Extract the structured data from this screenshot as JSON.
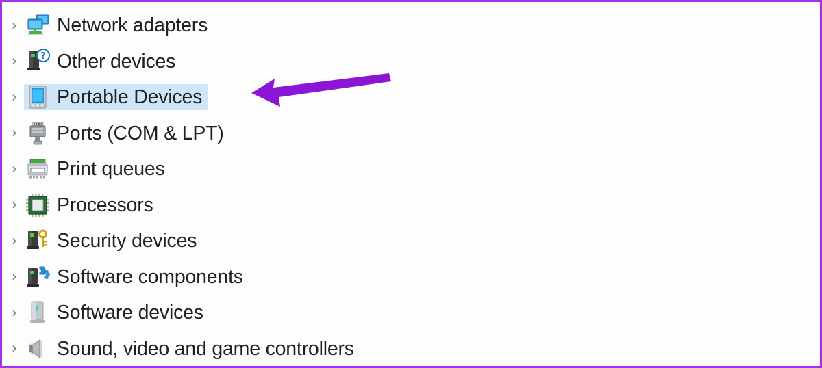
{
  "window": {
    "context": "device-manager-tree",
    "accent_border_color": "#a033e8",
    "selection_color": "#cfe5f8",
    "text_color": "#202124",
    "annotation_arrow_color": "#8b16d6"
  },
  "tree": {
    "expander_glyph": "›",
    "items": [
      {
        "label": "Network adapters",
        "icon": "network-adapters-icon",
        "selected": false,
        "expanded": false
      },
      {
        "label": "Other devices",
        "icon": "other-devices-icon",
        "selected": false,
        "expanded": false
      },
      {
        "label": "Portable Devices",
        "icon": "portable-devices-icon",
        "selected": true,
        "expanded": false
      },
      {
        "label": "Ports (COM & LPT)",
        "icon": "ports-icon",
        "selected": false,
        "expanded": false
      },
      {
        "label": "Print queues",
        "icon": "print-queues-icon",
        "selected": false,
        "expanded": false
      },
      {
        "label": "Processors",
        "icon": "processors-icon",
        "selected": false,
        "expanded": false
      },
      {
        "label": "Security devices",
        "icon": "security-devices-icon",
        "selected": false,
        "expanded": false
      },
      {
        "label": "Software components",
        "icon": "software-components-icon",
        "selected": false,
        "expanded": false
      },
      {
        "label": "Software devices",
        "icon": "software-devices-icon",
        "selected": false,
        "expanded": false
      },
      {
        "label": "Sound, video and game controllers",
        "icon": "sound-video-game-icon",
        "selected": false,
        "expanded": false
      }
    ]
  },
  "annotation": {
    "type": "arrow",
    "direction": "left",
    "points_to": "Portable Devices",
    "color": "#8b16d6"
  }
}
